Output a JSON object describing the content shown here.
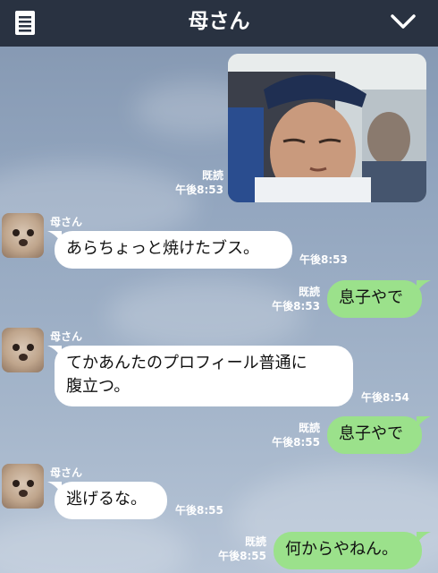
{
  "header": {
    "title": "母さん",
    "menu_icon": "document-list-icon",
    "collapse_icon": "chevron-down-icon"
  },
  "colors": {
    "header_bg": "#293241",
    "sent_bubble": "#9be18b",
    "received_bubble": "#ffffff",
    "background": "#93a6bf"
  },
  "messages": [
    {
      "id": "m1",
      "side": "right",
      "type": "photo",
      "read": "既読",
      "time": "午後8:53"
    },
    {
      "id": "m2",
      "side": "left",
      "sender": "母さん",
      "text": "あらちょっと焼けたブス。",
      "time": "午後8:53"
    },
    {
      "id": "m3",
      "side": "right",
      "text": "息子やで",
      "read": "既読",
      "time": "午後8:53"
    },
    {
      "id": "m4",
      "side": "left",
      "sender": "母さん",
      "line1": "てかあんたのプロフィール普通に",
      "line2": "腹立つ。",
      "time": "午後8:54"
    },
    {
      "id": "m5",
      "side": "right",
      "text": "息子やで",
      "read": "既読",
      "time": "午後8:55"
    },
    {
      "id": "m6",
      "side": "left",
      "sender": "母さん",
      "text": "逃げるな。",
      "time": "午後8:55"
    },
    {
      "id": "m7",
      "side": "right",
      "text": "何からやねん。",
      "read": "既読",
      "time": "午後8:55"
    }
  ]
}
